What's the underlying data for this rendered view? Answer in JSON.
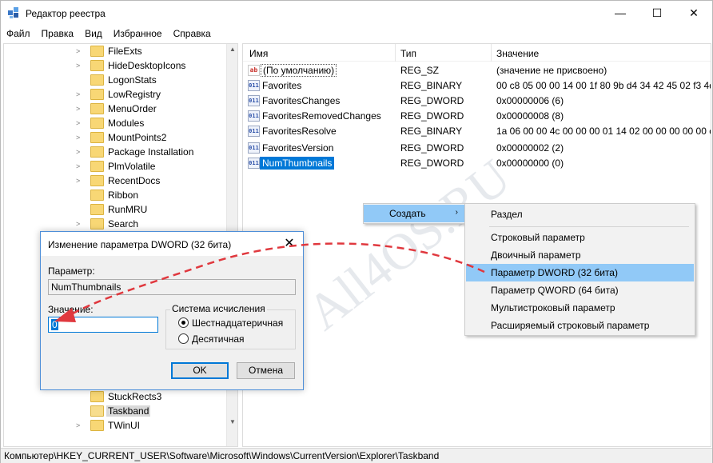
{
  "window": {
    "title": "Редактор реестра",
    "controls": {
      "minimize": "—",
      "maximize": "☐",
      "close": "✕"
    }
  },
  "menubar": [
    "Файл",
    "Правка",
    "Вид",
    "Избранное",
    "Справка"
  ],
  "tree": {
    "items": [
      {
        "label": "FileExts",
        "expandable": true
      },
      {
        "label": "HideDesktopIcons",
        "expandable": true
      },
      {
        "label": "LogonStats",
        "expandable": false
      },
      {
        "label": "LowRegistry",
        "expandable": true
      },
      {
        "label": "MenuOrder",
        "expandable": true
      },
      {
        "label": "Modules",
        "expandable": true
      },
      {
        "label": "MountPoints2",
        "expandable": true
      },
      {
        "label": "Package Installation",
        "expandable": true
      },
      {
        "label": "PlmVolatile",
        "expandable": true
      },
      {
        "label": "RecentDocs",
        "expandable": true
      },
      {
        "label": "Ribbon",
        "expandable": false
      },
      {
        "label": "RunMRU",
        "expandable": false
      },
      {
        "label": "Search",
        "expandable": true
      }
    ],
    "bottom_items": [
      {
        "label": "StuckRects3",
        "expandable": false
      },
      {
        "label": "Taskband",
        "expandable": false,
        "selected": true
      },
      {
        "label": "TWinUI",
        "expandable": true
      }
    ]
  },
  "list": {
    "columns": {
      "name": "Имя",
      "type": "Тип",
      "data": "Значение"
    },
    "rows": [
      {
        "icon": "ab",
        "name": "(По умолчанию)",
        "type": "REG_SZ",
        "data": "(значение не присвоено)"
      },
      {
        "icon": "bin",
        "name": "Favorites",
        "type": "REG_BINARY",
        "data": "00 c8 05 00 00 14 00 1f 80 9b d4 34 42 45 02 f3 4d b7..."
      },
      {
        "icon": "bin",
        "name": "FavoritesChanges",
        "type": "REG_DWORD",
        "data": "0x00000006 (6)"
      },
      {
        "icon": "bin",
        "name": "FavoritesRemovedChanges",
        "type": "REG_DWORD",
        "data": "0x00000008 (8)"
      },
      {
        "icon": "bin",
        "name": "FavoritesResolve",
        "type": "REG_BINARY",
        "data": "1a 06 00 00 4c 00 00 00 01 14 02 00 00 00 00 00 c0 00..."
      },
      {
        "icon": "bin",
        "name": "FavoritesVersion",
        "type": "REG_DWORD",
        "data": "0x00000002 (2)"
      },
      {
        "icon": "bin",
        "name": "NumThumbnails",
        "type": "REG_DWORD",
        "data": "0x00000000 (0)"
      }
    ]
  },
  "context_menu": {
    "create": "Создать",
    "submenu": {
      "key": "Раздел",
      "string": "Строковый параметр",
      "binary": "Двоичный параметр",
      "dword": "Параметр DWORD (32 бита)",
      "qword": "Параметр QWORD (64 бита)",
      "multistring": "Мультистроковый параметр",
      "expandable": "Расширяемый строковый параметр"
    }
  },
  "dialog": {
    "title": "Изменение параметра DWORD (32 бита)",
    "param_label": "Параметр:",
    "param_value": "NumThumbnails",
    "value_label": "Значение:",
    "value": "0",
    "base_label": "Система исчисления",
    "hex_label": "Шестнадцатеричная",
    "dec_label": "Десятичная",
    "ok": "OK",
    "cancel": "Отмена"
  },
  "watermark": "All4OS.RU",
  "statusbar": "Компьютер\\HKEY_CURRENT_USER\\Software\\Microsoft\\Windows\\CurrentVersion\\Explorer\\Taskband",
  "colors": {
    "accent": "#0078d7",
    "highlight": "#91c9f7",
    "arrow": "#e0383e"
  }
}
